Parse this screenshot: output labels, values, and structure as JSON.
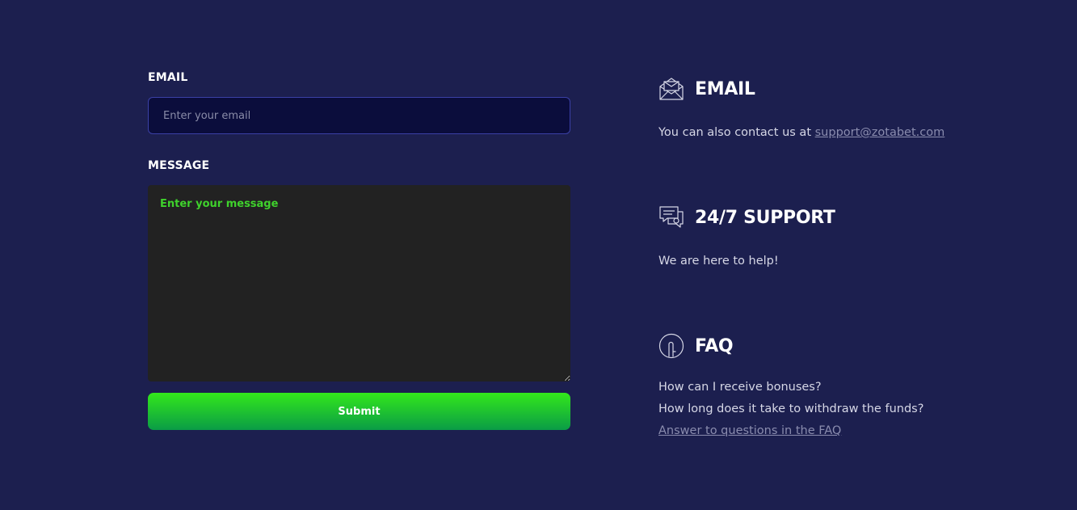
{
  "form": {
    "email_label": "EMAIL",
    "email_placeholder": "Enter your email",
    "message_label": "MESSAGE",
    "message_placeholder": "Enter your message",
    "submit_label": "Submit"
  },
  "contact": {
    "email": {
      "title": "EMAIL",
      "text": "You can also contact us at",
      "link": "support@zotabet.com",
      "icon": "envelope-icon"
    },
    "support": {
      "title": "24/7 SUPPORT",
      "text": "We are here to help!",
      "icon": "chat-bubbles-icon"
    },
    "faq": {
      "title": "FAQ",
      "questions": [
        "How can I receive bonuses?",
        "How long does it take to withdraw the funds?"
      ],
      "link": "Answer to questions in the FAQ",
      "icon": "question-circle-icon"
    }
  },
  "colors": {
    "background": "#1c1f4f",
    "input_background": "#0b0d3c",
    "input_border": "#3b40a6",
    "textarea_background": "#222222",
    "accent_green": "#33e81b",
    "link_color": "#8a8cae"
  }
}
